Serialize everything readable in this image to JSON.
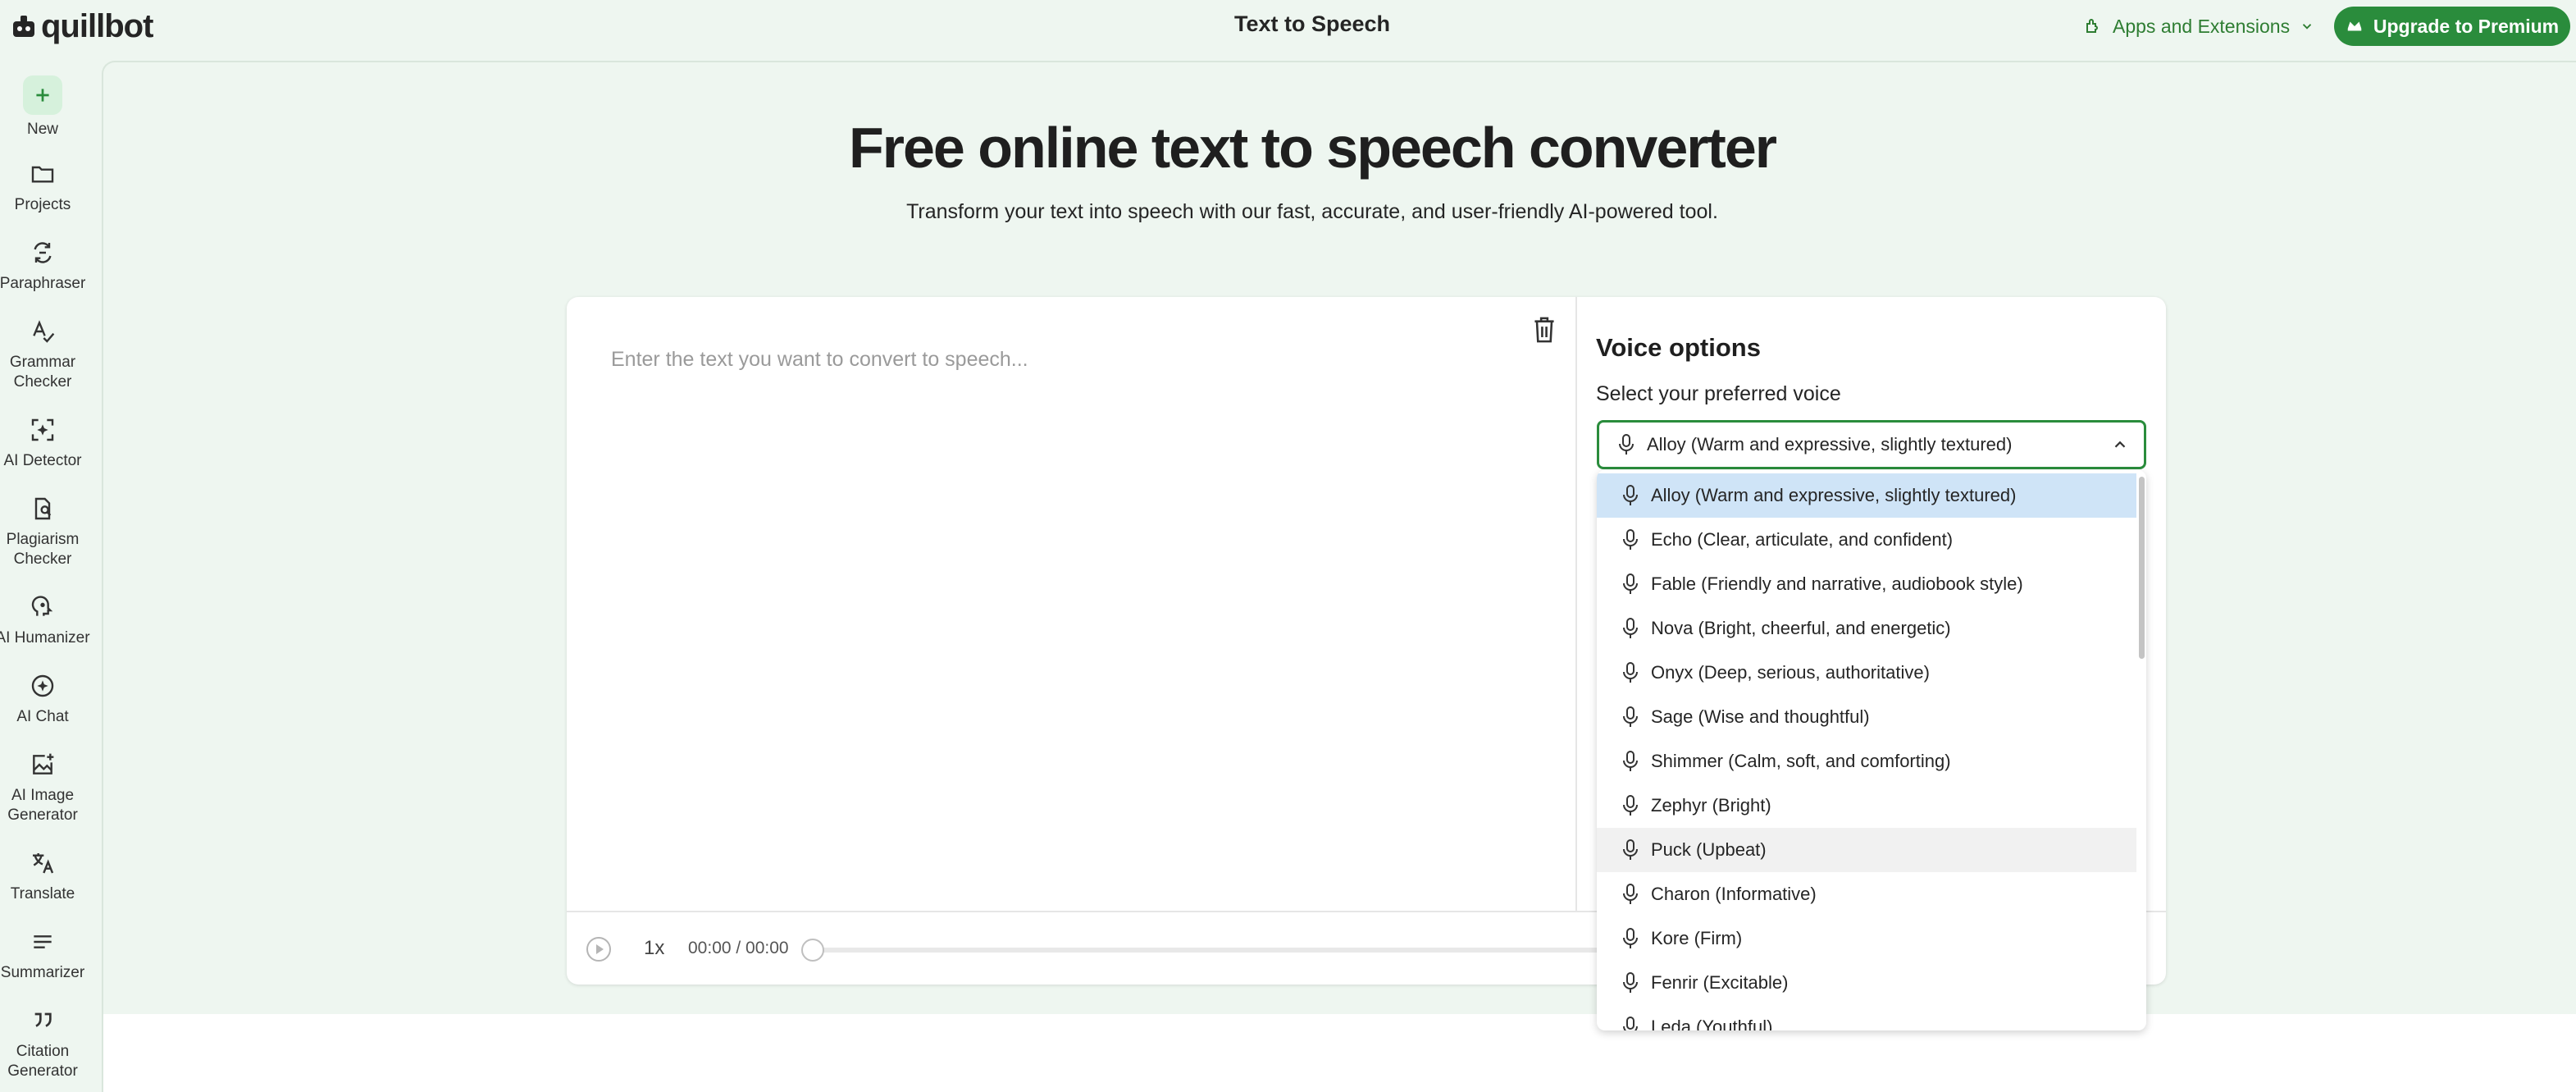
{
  "header": {
    "logo_text": "quillbot",
    "title": "Text to Speech",
    "apps_label": "Apps and Extensions",
    "upgrade_label": "Upgrade to Premium"
  },
  "sidebar": {
    "items": [
      {
        "label": "New",
        "icon": "plus-icon"
      },
      {
        "label": "Projects",
        "icon": "folder-icon"
      },
      {
        "label": "Paraphraser",
        "icon": "paraphraser-icon"
      },
      {
        "label": "Grammar Checker",
        "icon": "grammar-icon"
      },
      {
        "label": "AI Detector",
        "icon": "ai-detector-icon"
      },
      {
        "label": "Plagiarism Checker",
        "icon": "plagiarism-icon"
      },
      {
        "label": "AI Humanizer",
        "icon": "humanizer-icon"
      },
      {
        "label": "AI Chat",
        "icon": "chat-icon"
      },
      {
        "label": "AI Image Generator",
        "icon": "image-generator-icon"
      },
      {
        "label": "Translate",
        "icon": "translate-icon"
      },
      {
        "label": "Summarizer",
        "icon": "summarizer-icon"
      },
      {
        "label": "Citation Generator",
        "icon": "citation-icon"
      }
    ]
  },
  "hero": {
    "title": "Free online text to speech converter",
    "subtitle": "Transform your text into speech with our fast, accurate, and user-friendly AI-powered tool."
  },
  "editor": {
    "placeholder": "Enter the text you want to convert to speech..."
  },
  "voice_panel": {
    "title": "Voice options",
    "label": "Select your preferred voice",
    "selected": "Alloy (Warm and expressive, slightly textured)"
  },
  "player": {
    "speed": "1x",
    "time": "00:00 / 00:00"
  },
  "voice_options": [
    "Alloy (Warm and expressive, slightly textured)",
    "Echo (Clear, articulate, and confident)",
    "Fable (Friendly and narrative, audiobook style)",
    "Nova (Bright, cheerful, and energetic)",
    "Onyx (Deep, serious, authoritative)",
    "Sage (Wise and thoughtful)",
    "Shimmer (Calm, soft, and comforting)",
    "Zephyr (Bright)",
    "Puck (Upbeat)",
    "Charon (Informative)",
    "Kore (Firm)",
    "Fenrir (Excitable)",
    "Leda (Youthful)"
  ],
  "colors": {
    "brand": "#2a8c3c",
    "background": "#eef6f0",
    "selected_option": "#cfe4f7"
  }
}
